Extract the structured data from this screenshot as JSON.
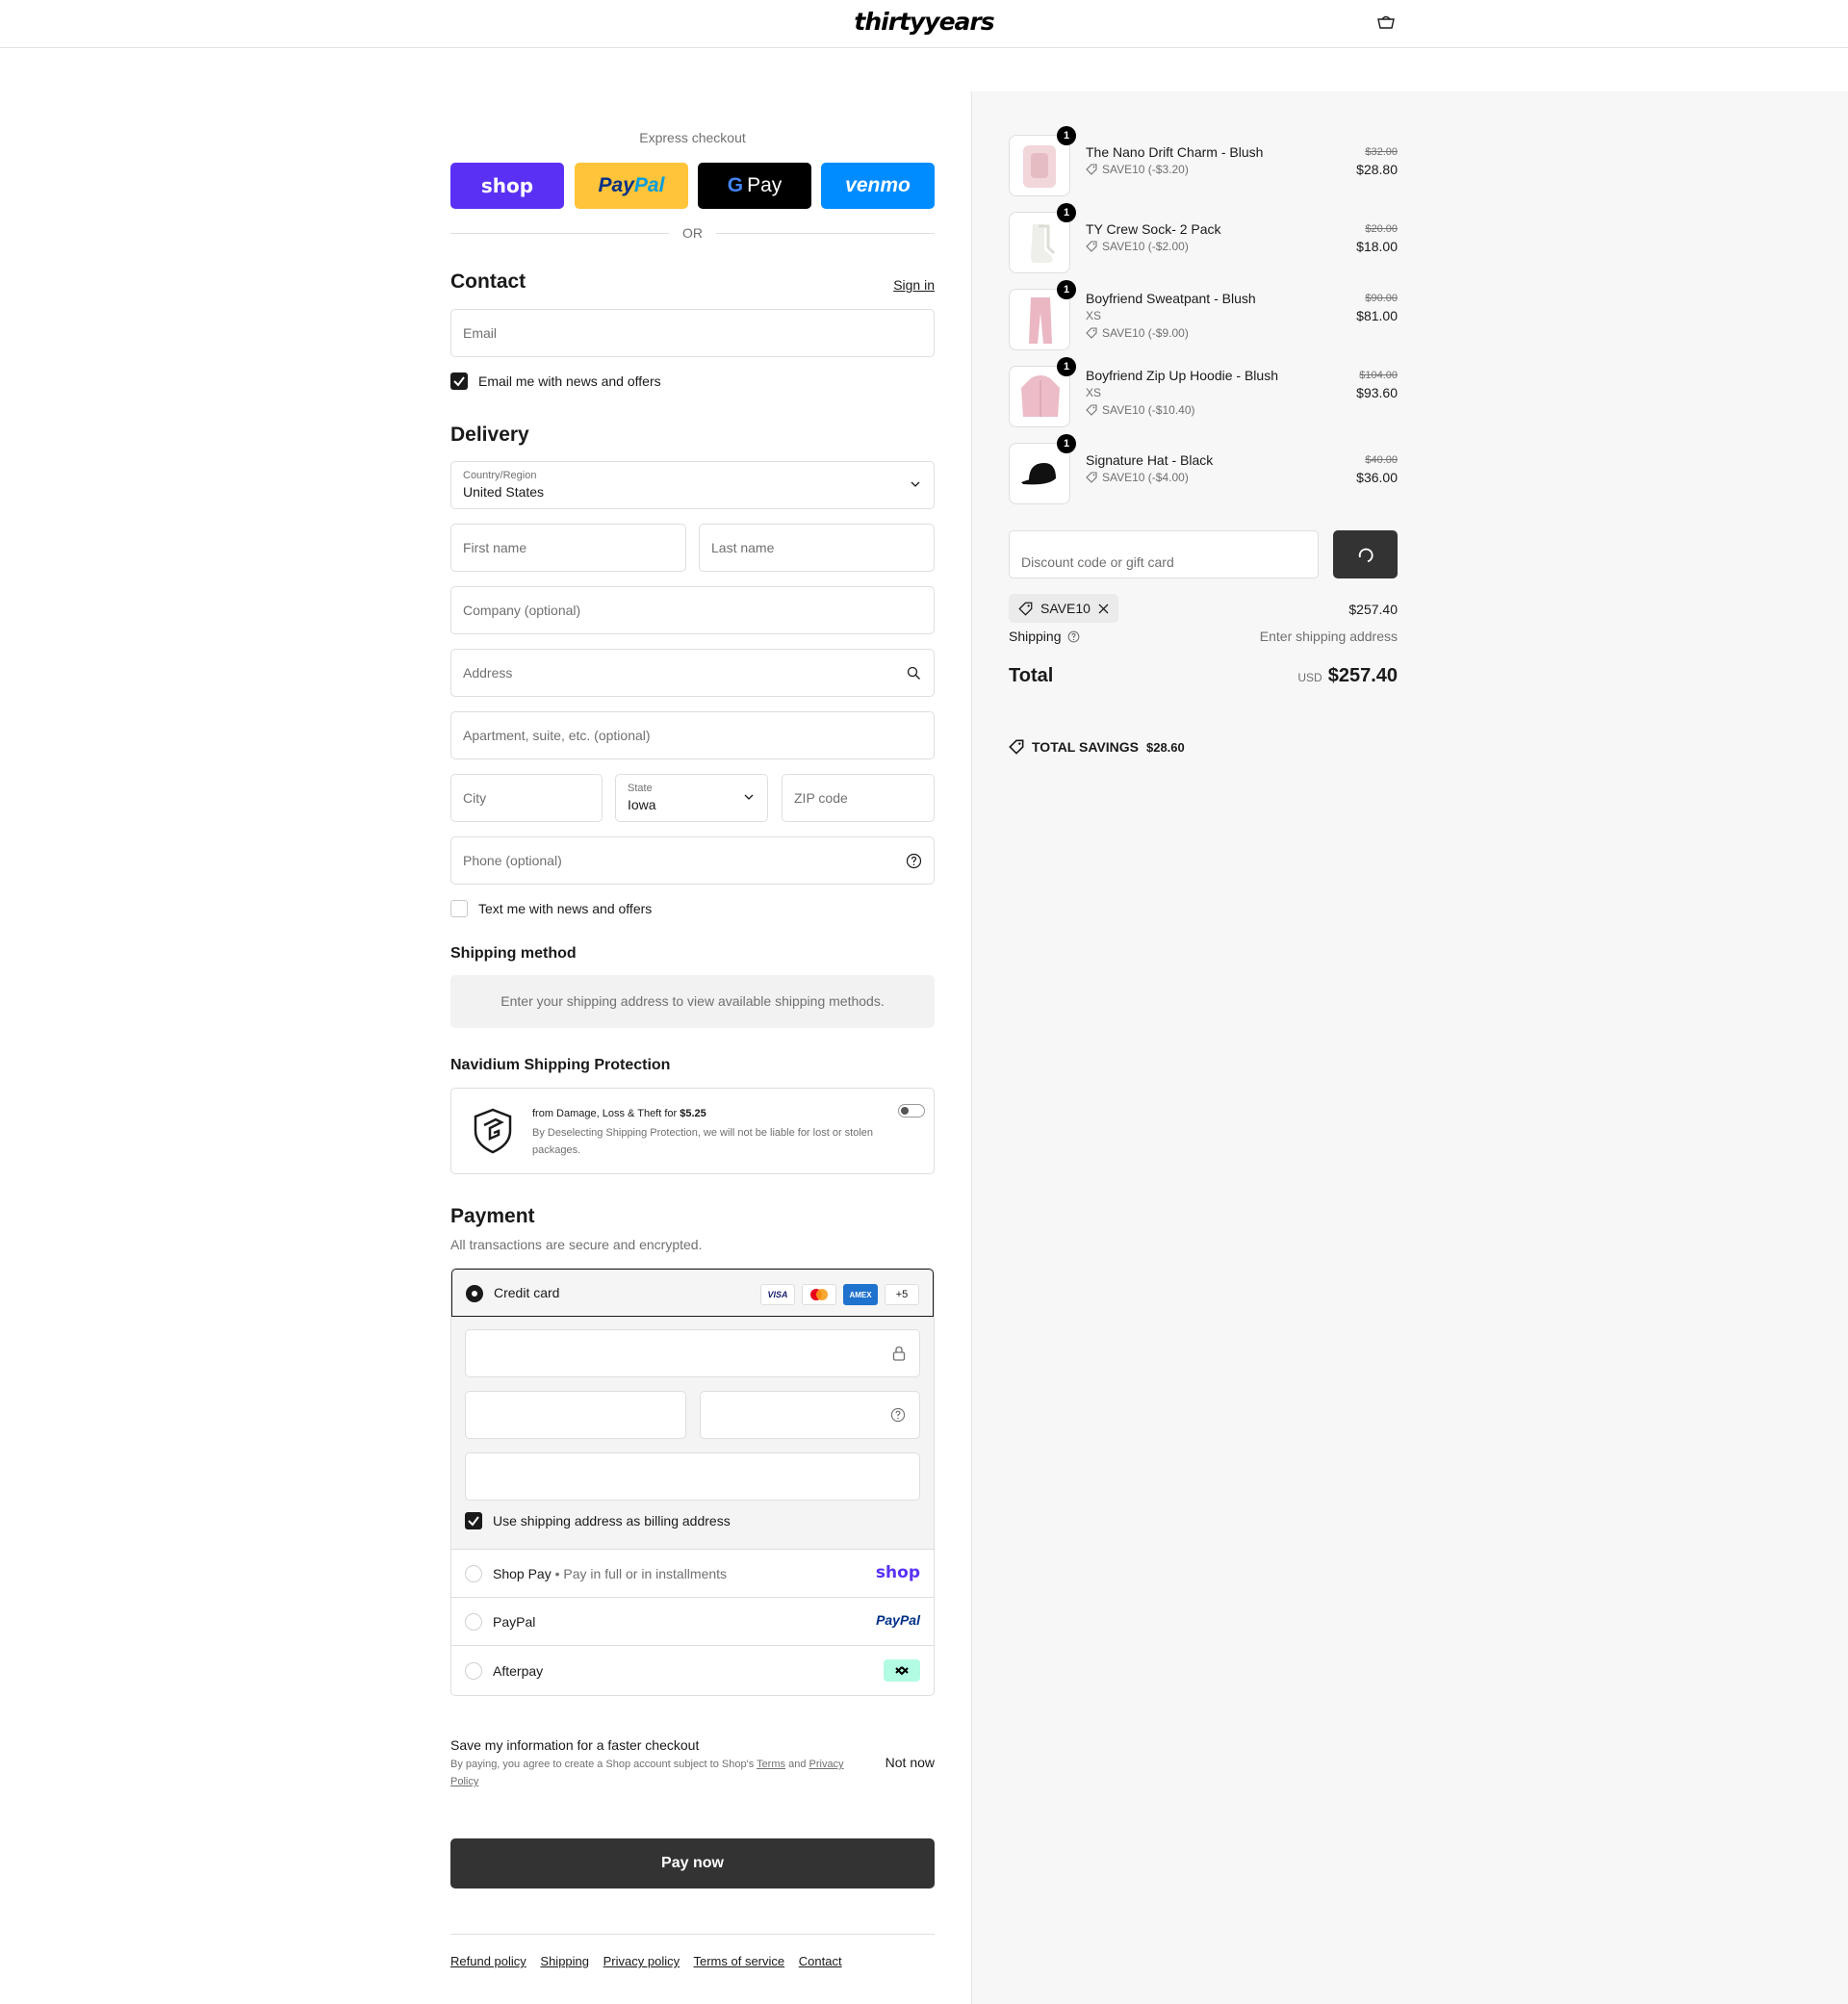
{
  "brand": {
    "logo": "thirtyyears"
  },
  "express": {
    "label": "Express checkout",
    "buttons": [
      {
        "name": "Shop Pay",
        "label": "shop",
        "color": "#5a31f4"
      },
      {
        "name": "PayPal",
        "label": "PayPal",
        "color": "#ffc439"
      },
      {
        "name": "Google Pay",
        "label": "Pay",
        "color": "#000000"
      },
      {
        "name": "Venmo",
        "label": "venmo",
        "color": "#008cff"
      }
    ],
    "or": "OR"
  },
  "contact": {
    "title": "Contact",
    "sign_in": "Sign in",
    "email_placeholder": "Email",
    "newsletter_label": "Email me with news and offers",
    "newsletter_checked": true
  },
  "delivery": {
    "title": "Delivery",
    "country_label": "Country/Region",
    "country_value": "United States",
    "first_name": "First name",
    "last_name": "Last name",
    "company": "Company (optional)",
    "address": "Address",
    "apartment": "Apartment, suite, etc. (optional)",
    "city": "City",
    "state_label": "State",
    "state_value": "Iowa",
    "zip": "ZIP code",
    "phone": "Phone (optional)",
    "sms_label": "Text me with news and offers",
    "sms_checked": false
  },
  "shipping_method": {
    "title": "Shipping method",
    "message": "Enter your shipping address to view available shipping methods."
  },
  "protection": {
    "title": "Navidium Shipping Protection",
    "line1": "from Damage, Loss & Theft for",
    "price": "$5.25",
    "line2": "By Deselecting Shipping Protection, we will not be liable for lost or stolen packages.",
    "enabled": false
  },
  "payment": {
    "title": "Payment",
    "subtitle": "All transactions are secure and encrypted.",
    "credit_card": "Credit card",
    "card_brands": [
      "VISA",
      "MC",
      "AMEX",
      "+5"
    ],
    "billing_same": "Use shipping address as billing address",
    "options": [
      {
        "label": "Shop Pay",
        "detail": "Pay in full or in installments",
        "logo": "shop"
      },
      {
        "label": "PayPal",
        "detail": "",
        "logo": "PayPal"
      },
      {
        "label": "Afterpay",
        "detail": "",
        "logo": "afterpay"
      }
    ]
  },
  "save_info": {
    "title": "Save my information for a faster checkout",
    "text_prefix": "By paying, you agree to create a Shop account subject to Shop's",
    "terms": "Terms",
    "and": "and",
    "privacy": "Privacy Policy",
    "not_now": "Not now"
  },
  "pay_now": "Pay now",
  "footer": [
    "Refund policy",
    "Shipping",
    "Privacy policy",
    "Terms of service",
    "Contact"
  ],
  "cart": {
    "items": [
      {
        "name": "The Nano Drift Charm - Blush",
        "variant": "",
        "discount": "SAVE10 (-$3.20)",
        "original": "$32.00",
        "price": "$28.80",
        "qty": "1"
      },
      {
        "name": "TY Crew Sock- 2 Pack",
        "variant": "",
        "discount": "SAVE10 (-$2.00)",
        "original": "$20.00",
        "price": "$18.00",
        "qty": "1"
      },
      {
        "name": "Boyfriend Sweatpant - Blush",
        "variant": "XS",
        "discount": "SAVE10 (-$9.00)",
        "original": "$90.00",
        "price": "$81.00",
        "qty": "1"
      },
      {
        "name": "Boyfriend Zip Up Hoodie - Blush",
        "variant": "XS",
        "discount": "SAVE10 (-$10.40)",
        "original": "$104.00",
        "price": "$93.60",
        "qty": "1"
      },
      {
        "name": "Signature Hat - Black",
        "variant": "",
        "discount": "SAVE10 (-$4.00)",
        "original": "$40.00",
        "price": "$36.00",
        "qty": "1"
      }
    ],
    "discount_placeholder": "Discount code or gift card",
    "applied_code": "SAVE10",
    "subtotal": "$257.40",
    "shipping_label": "Shipping",
    "shipping_value": "Enter shipping address",
    "total_label": "Total",
    "currency": "USD",
    "total": "$257.40",
    "savings_label": "TOTAL SAVINGS",
    "savings_value": "$28.60"
  }
}
